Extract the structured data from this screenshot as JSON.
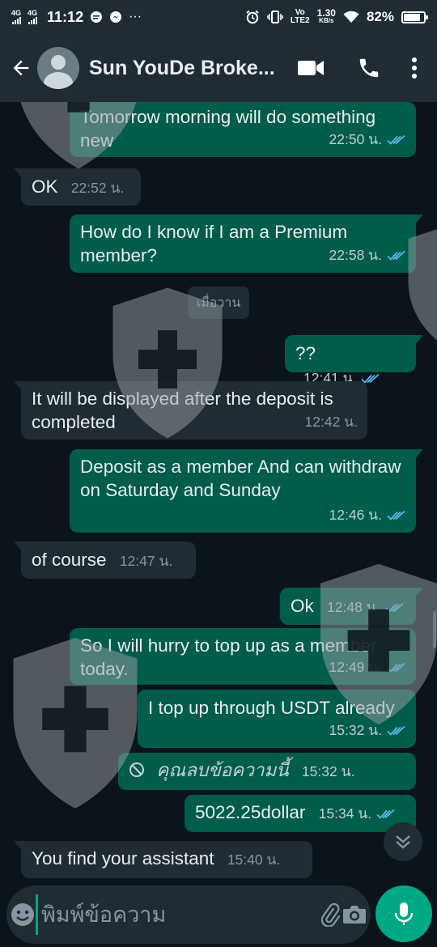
{
  "status_bar": {
    "network1": "4G",
    "network2": "4G",
    "time": "11:12",
    "volte_line1": "Vo",
    "volte_line2": "LTE2",
    "speed_value": "1.30",
    "speed_unit": "KB/s",
    "battery_percent": "82%",
    "battery_level": 0.82
  },
  "header": {
    "contact_name": "Sun YouDe Broke..."
  },
  "chat": {
    "date_divider": "เมื่อวาน",
    "messages": [
      {
        "text": "Tomorrow morning will do something new",
        "time": "22:50 น.",
        "direction": "out",
        "status": "read"
      },
      {
        "text": "OK",
        "time": "22:52 น.",
        "direction": "in"
      },
      {
        "text": "How do I know if I am a Premium member?",
        "time": "22:58 น.",
        "direction": "out",
        "status": "read"
      },
      {
        "text": "??",
        "time": "12:41 น.",
        "direction": "out",
        "status": "read"
      },
      {
        "text": "It will be displayed after the deposit is completed",
        "time": "12:42 น.",
        "direction": "in"
      },
      {
        "text": "Deposit as a member And can withdraw on Saturday and Sunday",
        "time": "12:46 น.",
        "direction": "out",
        "status": "read"
      },
      {
        "text": "of course",
        "time": "12:47 น.",
        "direction": "in"
      },
      {
        "text": "Ok",
        "time": "12:48 น.",
        "direction": "out",
        "status": "read"
      },
      {
        "text": "So I will hurry to top up as a member today.",
        "time": "12:49 น.",
        "direction": "out",
        "status": "read"
      },
      {
        "text": "I top up through USDT already",
        "time": "15:32 น.",
        "direction": "out",
        "status": "read"
      },
      {
        "text": "คุณลบข้อความนี้",
        "time": "15:32 น.",
        "direction": "out",
        "status": "deleted"
      },
      {
        "text": "5022.25dollar",
        "time": "15:34 น.",
        "direction": "out",
        "status": "read"
      },
      {
        "text": "You find your assistant",
        "time": "15:40 น.",
        "direction": "in"
      }
    ]
  },
  "input": {
    "placeholder": "พิมพ์ข้อความ"
  },
  "icons": {
    "back": "arrow-left-icon",
    "video": "video-camera-icon",
    "call": "phone-icon",
    "menu": "more-vert-icon",
    "emoji": "emoji-icon",
    "attach": "paperclip-icon",
    "camera": "camera-icon",
    "mic": "microphone-icon",
    "scroll": "double-chevron-down-icon",
    "ticks": "double-check-icon",
    "deleted": "blocked-icon"
  },
  "colors": {
    "header_bg": "#1f2c34",
    "outgoing_bubble": "#005c4b",
    "incoming_bubble": "#202c33",
    "accent": "#00a884",
    "read_ticks": "#53bdeb"
  }
}
